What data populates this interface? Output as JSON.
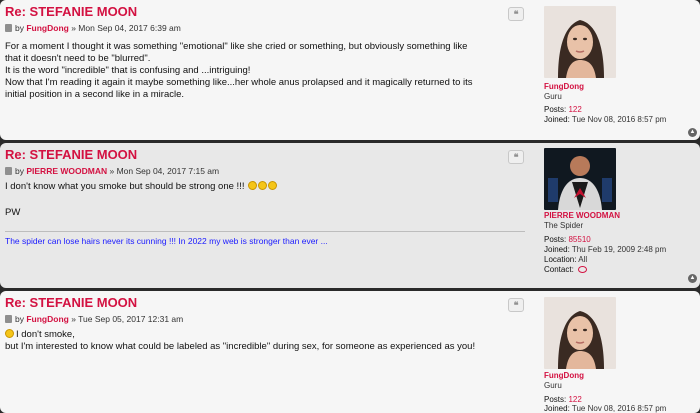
{
  "posts": [
    {
      "title": "Re: STEFANIE MOON",
      "by": "by",
      "author": "FungDong",
      "date": "» Mon Sep 04, 2017 6:39 am",
      "lines": [
        "For a moment I thought it was something \"emotional\" like she cried or something, but obviously something like",
        "that it doesn't need to be \"blurred\".",
        "It is the word \"incredible\" that is confusing and ...intriguing!",
        "Now that I'm reading it again it maybe something like...her whole anus prolapsed and it magically returned to its",
        "initial position in a second like in a miracle."
      ],
      "profile": {
        "name": "FungDong",
        "rank": "Guru",
        "posts_label": "Posts:",
        "posts_value": "122",
        "joined_label": "Joined:",
        "joined_value": "Tue Nov 08, 2016 8:57 pm"
      }
    },
    {
      "title": "Re: STEFANIE MOON",
      "by": "by",
      "author": "PIERRE WOODMAN",
      "date": "» Mon Sep 04, 2017 7:15 am",
      "line1": "I don't know what you smoke but should be strong one !!!",
      "line2": "PW",
      "signature": "The spider can lose hairs never its cunning !!! In 2022 my web is stronger than ever ...",
      "profile": {
        "name": "PIERRE WOODMAN",
        "rank": "The Spider",
        "posts_label": "Posts:",
        "posts_value": "85510",
        "joined_label": "Joined:",
        "joined_value": "Thu Feb 19, 2009 2:48 pm",
        "location_label": "Location:",
        "location_value": "All",
        "contact_label": "Contact:"
      }
    },
    {
      "title": "Re: STEFANIE MOON",
      "by": "by",
      "author": "FungDong",
      "date": "» Tue Sep 05, 2017 12:31 am",
      "line1": "I don't smoke,",
      "line2": "but I'm interested to know what could be labeled as \"incredible\" during sex, for someone as experienced as you!",
      "profile": {
        "name": "FungDong",
        "rank": "Guru",
        "posts_label": "Posts:",
        "posts_value": "122",
        "joined_label": "Joined:",
        "joined_value": "Tue Nov 08, 2016 8:57 pm"
      }
    }
  ],
  "icons": {
    "quote": "quote-icon",
    "post": "post-icon",
    "top": "back-to-top-icon",
    "laugh": "laughing-emoji-icon",
    "contact": "speech-bubble-icon"
  },
  "colors": {
    "accent": "#d31141",
    "signature": "#1a1aff"
  }
}
